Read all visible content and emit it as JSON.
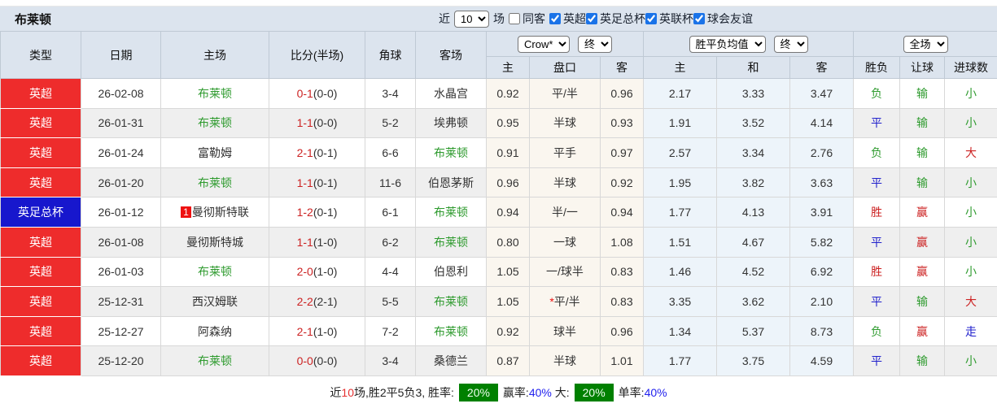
{
  "title": "布莱顿",
  "controls": {
    "recent_label": "近",
    "match_count": "10",
    "recent_suffix": "场",
    "same_opponent_label": "同客",
    "same_opponent_checked": false,
    "leagues": [
      {
        "label": "英超",
        "checked": true
      },
      {
        "label": "英足总杯",
        "checked": true
      },
      {
        "label": "英联杯",
        "checked": true
      },
      {
        "label": "球会友谊",
        "checked": true
      }
    ]
  },
  "table": {
    "columns": [
      "类型",
      "日期",
      "主场",
      "比分(半场)",
      "角球",
      "客场"
    ],
    "odds_group": {
      "select1": "Crow*",
      "select2": "终"
    },
    "avg_group": {
      "select1": "胜平负均值",
      "select2": "终"
    },
    "result_group": {
      "select1": "全场"
    },
    "sub_headers": [
      "主",
      "盘口",
      "客",
      "主",
      "和",
      "客",
      "胜负",
      "让球",
      "进球数"
    ],
    "rows": [
      {
        "type": "英超",
        "type_color": "red",
        "date": "26-02-08",
        "home": "布莱顿",
        "home_green": true,
        "home_badge": "",
        "score": "0-1",
        "half": "(0-0)",
        "corner": "3-4",
        "away": "水晶宫",
        "away_green": false,
        "odds_home": "0.92",
        "handicap": "平/半",
        "handicap_star": false,
        "odds_away": "0.96",
        "avg_home": "2.17",
        "avg_draw": "3.33",
        "avg_away": "3.47",
        "result_wdl": {
          "t": "负",
          "c": "green"
        },
        "result_handicap": {
          "t": "输",
          "c": "green"
        },
        "result_goals": {
          "t": "小",
          "c": "green"
        }
      },
      {
        "type": "英超",
        "type_color": "red",
        "date": "26-01-31",
        "home": "布莱顿",
        "home_green": true,
        "home_badge": "",
        "score": "1-1",
        "half": "(0-0)",
        "corner": "5-2",
        "away": "埃弗顿",
        "away_green": false,
        "odds_home": "0.95",
        "handicap": "半球",
        "handicap_star": false,
        "odds_away": "0.93",
        "avg_home": "1.91",
        "avg_draw": "3.52",
        "avg_away": "4.14",
        "result_wdl": {
          "t": "平",
          "c": "blue"
        },
        "result_handicap": {
          "t": "输",
          "c": "green"
        },
        "result_goals": {
          "t": "小",
          "c": "green"
        }
      },
      {
        "type": "英超",
        "type_color": "red",
        "date": "26-01-24",
        "home": "富勒姆",
        "home_green": false,
        "home_badge": "",
        "score": "2-1",
        "half": "(0-1)",
        "corner": "6-6",
        "away": "布莱顿",
        "away_green": true,
        "odds_home": "0.91",
        "handicap": "平手",
        "handicap_star": false,
        "odds_away": "0.97",
        "avg_home": "2.57",
        "avg_draw": "3.34",
        "avg_away": "2.76",
        "result_wdl": {
          "t": "负",
          "c": "green"
        },
        "result_handicap": {
          "t": "输",
          "c": "green"
        },
        "result_goals": {
          "t": "大",
          "c": "red"
        }
      },
      {
        "type": "英超",
        "type_color": "red",
        "date": "26-01-20",
        "home": "布莱顿",
        "home_green": true,
        "home_badge": "",
        "score": "1-1",
        "half": "(0-1)",
        "corner": "11-6",
        "away": "伯恩茅斯",
        "away_green": false,
        "odds_home": "0.96",
        "handicap": "半球",
        "handicap_star": false,
        "odds_away": "0.92",
        "avg_home": "1.95",
        "avg_draw": "3.82",
        "avg_away": "3.63",
        "result_wdl": {
          "t": "平",
          "c": "blue"
        },
        "result_handicap": {
          "t": "输",
          "c": "green"
        },
        "result_goals": {
          "t": "小",
          "c": "green"
        }
      },
      {
        "type": "英足总杯",
        "type_color": "blue",
        "date": "26-01-12",
        "home": "曼彻斯特联",
        "home_green": false,
        "home_badge": "1",
        "score": "1-2",
        "half": "(0-1)",
        "corner": "6-1",
        "away": "布莱顿",
        "away_green": true,
        "odds_home": "0.94",
        "handicap": "半/一",
        "handicap_star": false,
        "odds_away": "0.94",
        "avg_home": "1.77",
        "avg_draw": "4.13",
        "avg_away": "3.91",
        "result_wdl": {
          "t": "胜",
          "c": "red"
        },
        "result_handicap": {
          "t": "赢",
          "c": "red"
        },
        "result_goals": {
          "t": "小",
          "c": "green"
        }
      },
      {
        "type": "英超",
        "type_color": "red",
        "date": "26-01-08",
        "home": "曼彻斯特城",
        "home_green": false,
        "home_badge": "",
        "score": "1-1",
        "half": "(1-0)",
        "corner": "6-2",
        "away": "布莱顿",
        "away_green": true,
        "odds_home": "0.80",
        "handicap": "一球",
        "handicap_star": false,
        "odds_away": "1.08",
        "avg_home": "1.51",
        "avg_draw": "4.67",
        "avg_away": "5.82",
        "result_wdl": {
          "t": "平",
          "c": "blue"
        },
        "result_handicap": {
          "t": "赢",
          "c": "red"
        },
        "result_goals": {
          "t": "小",
          "c": "green"
        }
      },
      {
        "type": "英超",
        "type_color": "red",
        "date": "26-01-03",
        "home": "布莱顿",
        "home_green": true,
        "home_badge": "",
        "score": "2-0",
        "half": "(1-0)",
        "corner": "4-4",
        "away": "伯恩利",
        "away_green": false,
        "odds_home": "1.05",
        "handicap": "一/球半",
        "handicap_star": false,
        "odds_away": "0.83",
        "avg_home": "1.46",
        "avg_draw": "4.52",
        "avg_away": "6.92",
        "result_wdl": {
          "t": "胜",
          "c": "red"
        },
        "result_handicap": {
          "t": "赢",
          "c": "red"
        },
        "result_goals": {
          "t": "小",
          "c": "green"
        }
      },
      {
        "type": "英超",
        "type_color": "red",
        "date": "25-12-31",
        "home": "西汉姆联",
        "home_green": false,
        "home_badge": "",
        "score": "2-2",
        "half": "(2-1)",
        "corner": "5-5",
        "away": "布莱顿",
        "away_green": true,
        "odds_home": "1.05",
        "handicap": "平/半",
        "handicap_star": true,
        "odds_away": "0.83",
        "avg_home": "3.35",
        "avg_draw": "3.62",
        "avg_away": "2.10",
        "result_wdl": {
          "t": "平",
          "c": "blue"
        },
        "result_handicap": {
          "t": "输",
          "c": "green"
        },
        "result_goals": {
          "t": "大",
          "c": "red"
        }
      },
      {
        "type": "英超",
        "type_color": "red",
        "date": "25-12-27",
        "home": "阿森纳",
        "home_green": false,
        "home_badge": "",
        "score": "2-1",
        "half": "(1-0)",
        "corner": "7-2",
        "away": "布莱顿",
        "away_green": true,
        "odds_home": "0.92",
        "handicap": "球半",
        "handicap_star": false,
        "odds_away": "0.96",
        "avg_home": "1.34",
        "avg_draw": "5.37",
        "avg_away": "8.73",
        "result_wdl": {
          "t": "负",
          "c": "green"
        },
        "result_handicap": {
          "t": "赢",
          "c": "red"
        },
        "result_goals": {
          "t": "走",
          "c": "blue"
        }
      },
      {
        "type": "英超",
        "type_color": "red",
        "date": "25-12-20",
        "home": "布莱顿",
        "home_green": true,
        "home_badge": "",
        "score": "0-0",
        "half": "(0-0)",
        "corner": "3-4",
        "away": "桑德兰",
        "away_green": false,
        "odds_home": "0.87",
        "handicap": "半球",
        "handicap_star": false,
        "odds_away": "1.01",
        "avg_home": "1.77",
        "avg_draw": "3.75",
        "avg_away": "4.59",
        "result_wdl": {
          "t": "平",
          "c": "blue"
        },
        "result_handicap": {
          "t": "输",
          "c": "green"
        },
        "result_goals": {
          "t": "小",
          "c": "green"
        }
      }
    ]
  },
  "footer": {
    "prefix": "近",
    "count": "10",
    "mid": "场,胜2平5负3, 胜率:",
    "win_rate": "20%",
    "seg2": "赢率:",
    "win_odds_rate": "40%",
    "seg3": " 大:",
    "big_rate": "20%",
    "seg4": "单率:",
    "odd_rate": "40%"
  },
  "colors": {
    "league_red": "#ee2c2c",
    "cup_blue": "#1717cd",
    "team_green": "#2f9b2f",
    "score_red": "#cc2222",
    "result_blue": "#2222cc",
    "badge_green": "#008000",
    "header_bg": "#dce4ee",
    "odds_col_bg": "#faf6ef",
    "avg_col_bg": "#edf4fa"
  }
}
